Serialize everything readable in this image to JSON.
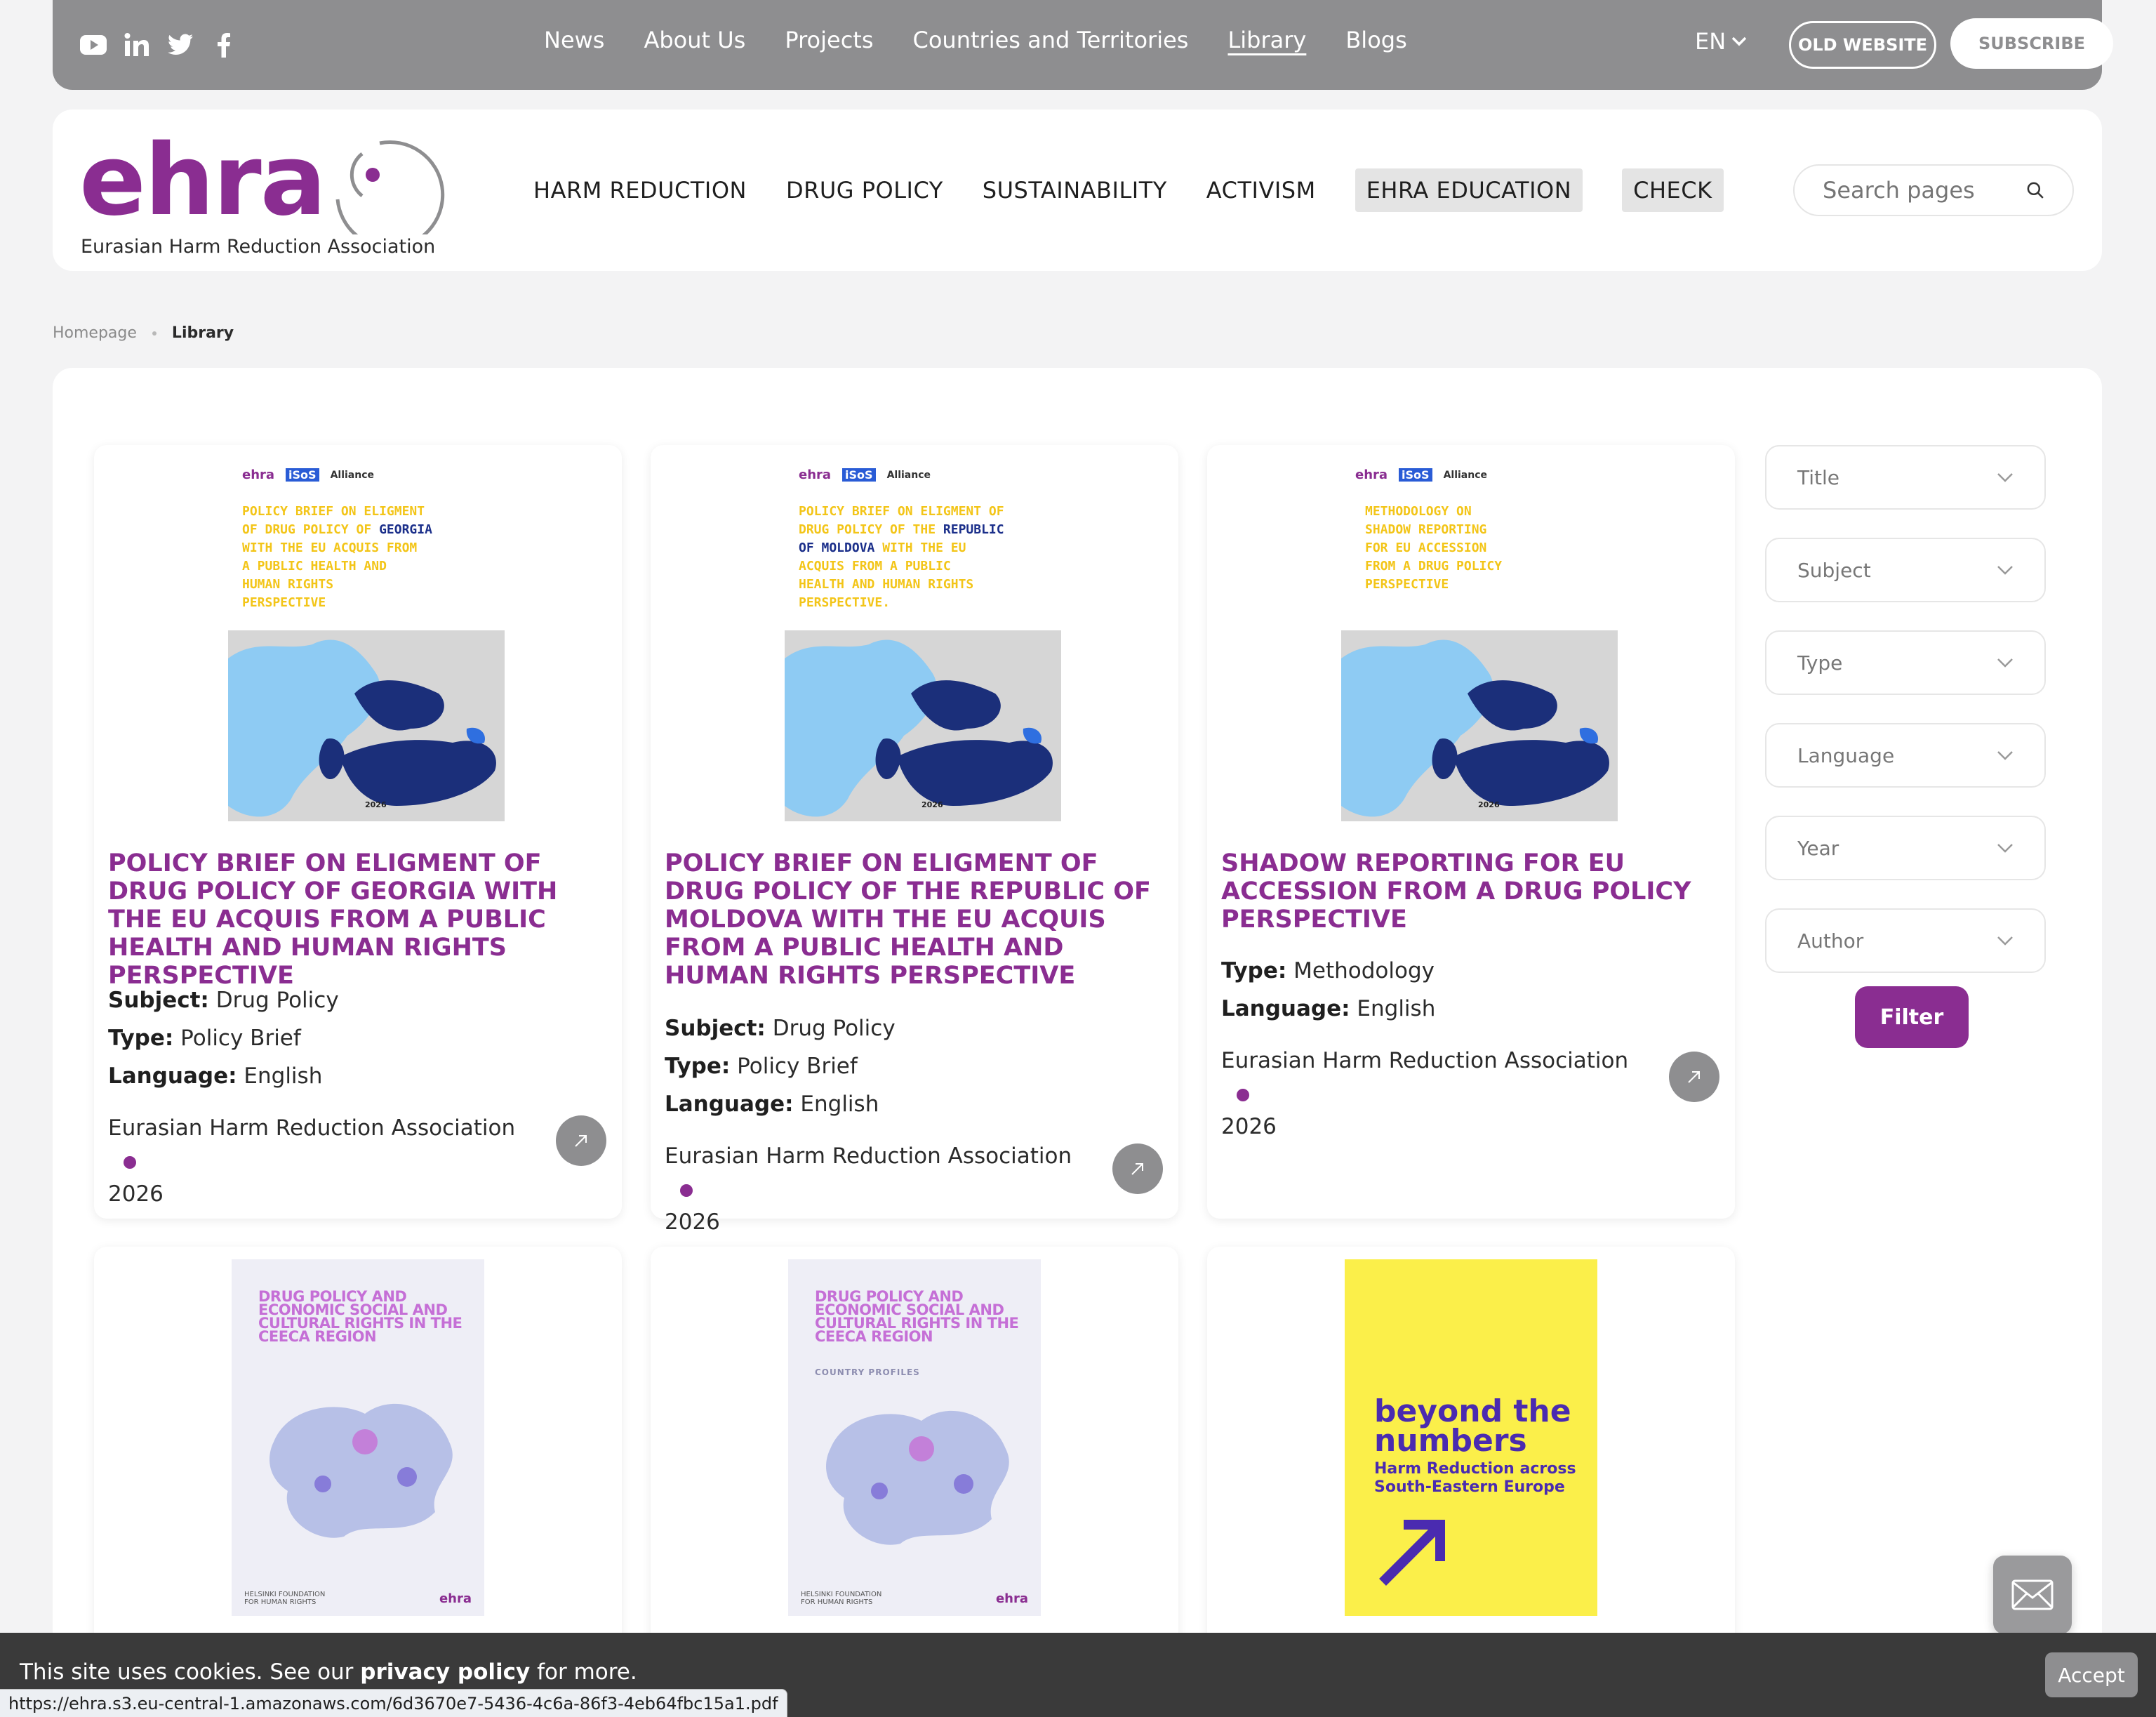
{
  "topbar": {
    "social": [
      "youtube-icon",
      "linkedin-icon",
      "twitter-icon",
      "facebook-icon"
    ],
    "nav": [
      "News",
      "About Us",
      "Projects",
      "Countries and Territories",
      "Library",
      "Blogs"
    ],
    "active_nav": "Library",
    "language": "EN",
    "old_website": "OLD WEBSITE",
    "subscribe": "SUBSCRIBE"
  },
  "header": {
    "logo_text": "ehra",
    "logo_subtitle": "Eurasian Harm Reduction Association",
    "nav": [
      "HARM REDUCTION",
      "DRUG POLICY",
      "SUSTAINABILITY",
      "ACTIVISM",
      "EHRA EDUCATION",
      "CHECK"
    ],
    "search_placeholder": "Search pages"
  },
  "breadcrumb": {
    "home": "Homepage",
    "current": "Library"
  },
  "cards": [
    {
      "cover_lines": [
        "POLICY BRIEF ON ELIGMENT",
        "OF DRUG POLICY OF ",
        "GEORGIA",
        "WITH THE EU ACQUIS FROM",
        "A PUBLIC HEALTH AND",
        "HUMAN RIGHTS",
        "PERSPECTIVE"
      ],
      "cover_year": "2026",
      "title": "POLICY BRIEF ON ELIGMENT OF DRUG POLICY OF GEORGIA WITH THE EU ACQUIS FROM A PUBLIC HEALTH AND HUMAN RIGHTS PERSPECTIVE",
      "subject_label": "Subject:",
      "subject": "Drug Policy",
      "type_label": "Type:",
      "type": "Policy Brief",
      "language_label": "Language:",
      "language": "English",
      "author": "Eurasian Harm Reduction Association",
      "year": "2026"
    },
    {
      "cover_lines": [
        "POLICY BRIEF ON ELIGMENT OF",
        "DRUG POLICY OF THE ",
        "REPUBLIC",
        "OF MOLDOVA",
        " WITH THE EU",
        "ACQUIS FROM A PUBLIC",
        "HEALTH AND HUMAN RIGHTS",
        "PERSPECTIVE."
      ],
      "cover_year": "2026",
      "title": "POLICY BRIEF ON ELIGMENT OF DRUG POLICY OF THE REPUBLIC OF MOLDOVA WITH THE EU ACQUIS FROM A PUBLIC HEALTH AND HUMAN RIGHTS PERSPECTIVE",
      "subject_label": "Subject:",
      "subject": "Drug Policy",
      "type_label": "Type:",
      "type": "Policy Brief",
      "language_label": "Language:",
      "language": "English",
      "author": "Eurasian Harm Reduction Association",
      "year": "2026"
    },
    {
      "cover_lines": [
        "METHODOLOGY ON",
        "SHADOW REPORTING",
        "FOR EU ACCESSION",
        "FROM A DRUG POLICY",
        "PERSPECTIVE"
      ],
      "cover_year": "2026",
      "title": "SHADOW REPORTING FOR EU ACCESSION FROM A DRUG POLICY PERSPECTIVE",
      "type_label": "Type:",
      "type": "Methodology",
      "language_label": "Language:",
      "language": "English",
      "author": "Eurasian Harm Reduction Association",
      "year": "2026"
    }
  ],
  "cards_row2": [
    {
      "cover_title": "DRUG POLICY AND ECONOMIC SOCIAL AND CULTURAL RIGHTS IN THE CEECA REGION",
      "cover_sub": "",
      "foot_left": "HELSINKI FOUNDATION FOR HUMAN RIGHTS",
      "foot_right": "ehra"
    },
    {
      "cover_title": "DRUG POLICY AND ECONOMIC SOCIAL AND CULTURAL RIGHTS IN THE CEECA REGION",
      "cover_sub": "COUNTRY PROFILES",
      "foot_left": "HELSINKI FOUNDATION FOR HUMAN RIGHTS",
      "foot_right": "ehra"
    },
    {
      "cover_t1": "beyond the numbers",
      "cover_t2": "Harm Reduction across South-Eastern Europe"
    }
  ],
  "filters": [
    "Title",
    "Subject",
    "Type",
    "Language",
    "Year",
    "Author"
  ],
  "filter_button": "Filter",
  "cookie": {
    "text_before": "This site uses cookies. See our ",
    "link": "privacy policy",
    "text_after": " for more.",
    "accept": "Accept"
  },
  "status_url": "https://ehra.s3.eu-central-1.amazonaws.com/6d3670e7-5436-4c6a-86f3-4eb64fbc15a1.pdf",
  "colors": {
    "brand": "#8a2d91",
    "gray": "#8e8e90",
    "cover_yellow": "#f3c518",
    "cover_blue": "#1b2f8a"
  }
}
